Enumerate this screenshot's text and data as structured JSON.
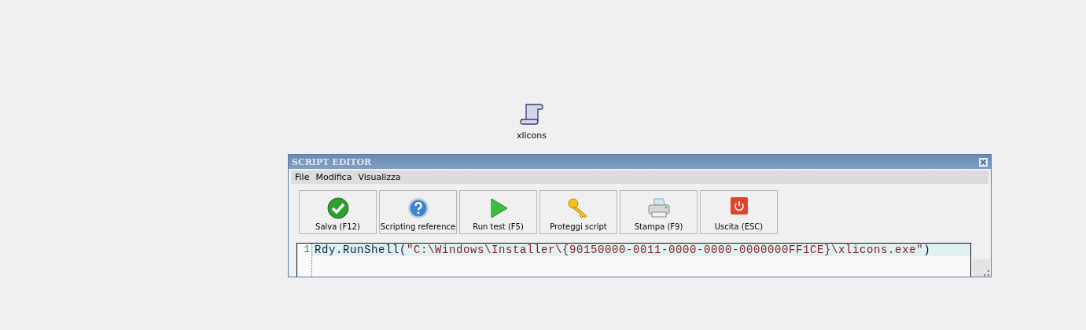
{
  "desktop_icon": {
    "label": "xlicons"
  },
  "window": {
    "title": "SCRIPT EDITOR"
  },
  "menu": [
    "File",
    "Modifica",
    "Visualizza"
  ],
  "toolbar": [
    {
      "kind": "save",
      "label": "Salva (F12)"
    },
    {
      "kind": "help",
      "label": "Scripting reference"
    },
    {
      "kind": "run",
      "label": "Run test (F5)"
    },
    {
      "kind": "protect",
      "label": "Proteggi script"
    },
    {
      "kind": "print",
      "label": "Stampa (F9)"
    },
    {
      "kind": "exit",
      "label": "Uscita (ESC)"
    }
  ],
  "editor": {
    "lines": [
      {
        "number": "1",
        "current": true,
        "parts": [
          {
            "kind": "code",
            "text": "Rdy.RunShell("
          },
          {
            "kind": "string",
            "text": "\"C:\\Windows\\Installer\\{90150000-0011-0000-0000-0000000FF1CE}\\xlicons.exe\""
          },
          {
            "kind": "code",
            "text": ")"
          }
        ]
      }
    ]
  }
}
